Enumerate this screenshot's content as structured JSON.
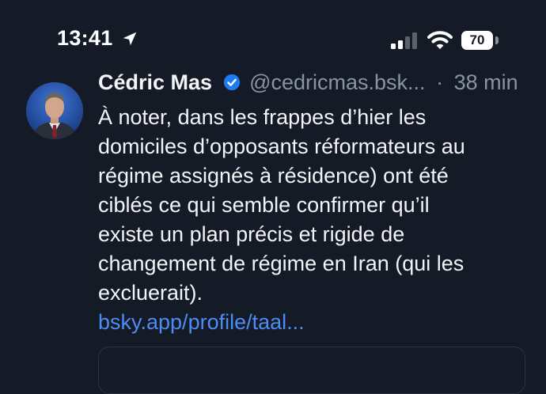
{
  "status_bar": {
    "time": "13:41",
    "battery_level": "70",
    "icons": [
      "location-arrow-icon",
      "cellular-signal-icon",
      "wifi-icon",
      "battery-icon"
    ]
  },
  "post": {
    "author_name": "Cédric Mas",
    "handle": "@cedricmas.bsk...",
    "separator": "·",
    "timestamp": "38 min",
    "text_lines": [
      "À noter, dans les frappes d’hier les",
      "domiciles d’opposants réformateurs au",
      "régime assignés à résidence) ont été",
      "ciblés ce qui semble confirmer qu’il",
      "existe un plan précis et rigide de",
      "changement de régime en Iran (qui les",
      "excluerait)."
    ],
    "link": "bsky.app/profile/taal..."
  },
  "colors": {
    "background": "#151b26",
    "text": "#f2f4f7",
    "muted": "#8893a5",
    "link": "#4c8cf5",
    "verified": "#1d7cf2"
  }
}
